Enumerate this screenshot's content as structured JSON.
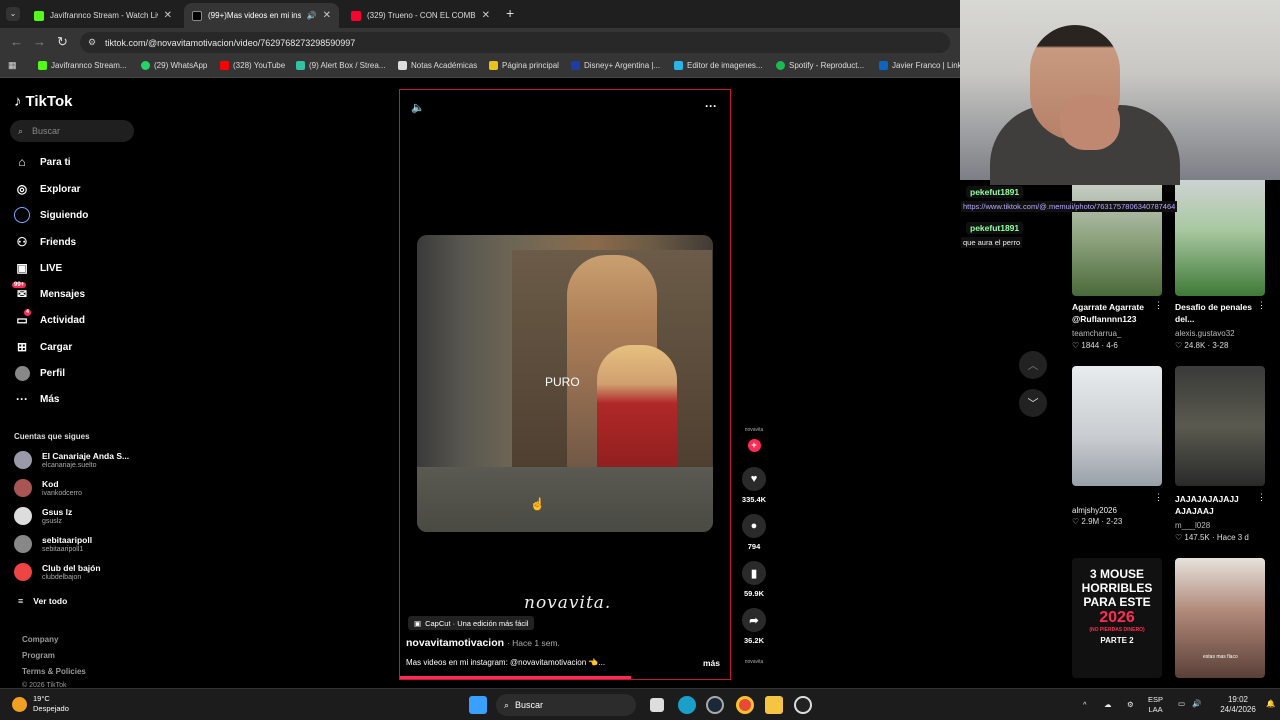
{
  "browser": {
    "tabs": [
      {
        "title": "Javifrannco Stream - Watch Live",
        "color": "#53fc18"
      },
      {
        "title": "(99+)Mas videos en mi insta...",
        "color": "#ffffff"
      },
      {
        "title": "(329) Trueno - CON EL COMBO",
        "color": "#ff0033"
      }
    ],
    "url": "tiktok.com/@novavitamotivacion/video/7629768273298590997",
    "bookmarks": [
      {
        "label": "Javifrannco Stream...",
        "color": "#53fc18"
      },
      {
        "label": "(29) WhatsApp",
        "color": "#25d366"
      },
      {
        "label": "(328) YouTube",
        "color": "#ff0000"
      },
      {
        "label": "(9) Alert Box / Strea...",
        "color": "#31c3a2"
      },
      {
        "label": "Notas Académicas",
        "color": "#dddddd"
      },
      {
        "label": "Página principal",
        "color": "#e8c21f"
      },
      {
        "label": "Disney+ Argentina |...",
        "color": "#1c3ca8"
      },
      {
        "label": "Editor de imagenes...",
        "color": "#2bb5e6"
      },
      {
        "label": "Spotify - Reproduct...",
        "color": "#1db954"
      },
      {
        "label": "Javier Franco | Link...",
        "color": "#0a66c2"
      }
    ]
  },
  "tiktok": {
    "logo": "TikTok",
    "search_placeholder": "Buscar",
    "nav": [
      {
        "label": "Para ti",
        "icon": "home-icon"
      },
      {
        "label": "Explorar",
        "icon": "compass-icon"
      },
      {
        "label": "Siguiendo",
        "icon": "following-icon"
      },
      {
        "label": "Friends",
        "icon": "friends-icon"
      },
      {
        "label": "LIVE",
        "icon": "live-icon"
      },
      {
        "label": "Mensajes",
        "icon": "messages-icon",
        "badge": "99+"
      },
      {
        "label": "Actividad",
        "icon": "activity-icon",
        "badge": "4"
      },
      {
        "label": "Cargar",
        "icon": "upload-icon"
      },
      {
        "label": "Perfil",
        "icon": "profile-icon"
      },
      {
        "label": "Más",
        "icon": "more-icon"
      }
    ],
    "following_title": "Cuentas que sigues",
    "following": [
      {
        "name": "El Canariaje Anda S...",
        "handle": "elcanariaje.suelto"
      },
      {
        "name": "Kod",
        "handle": "ivankodcerro"
      },
      {
        "name": "Gsus lz",
        "handle": "gsuslz"
      },
      {
        "name": "sebitaaripoll",
        "handle": "sebitaaripoll1"
      },
      {
        "name": "Club del bajón",
        "handle": "clubdelbajon"
      }
    ],
    "see_all": "Ver todo",
    "footer": [
      "Company",
      "Program",
      "Terms & Policies",
      "© 2026 TikTok"
    ],
    "video": {
      "overlay_text": "PURO",
      "brand": "novavita.",
      "capcut": "CapCut · Una edición más fácil",
      "username": "novavitamotivacion",
      "time": "· Hace 1 sem.",
      "description": "Mas videos en mi instagram: @novavitamotivacion 👈...",
      "more": "más",
      "progress": 0.7,
      "avatar_label": "novavita",
      "likes": "335.4K",
      "comments": "794",
      "saves": "59.9K",
      "shares": "36.2K",
      "end_label": "novavita"
    },
    "related": [
      {
        "caption": "Agarrate Agarrate @Ruflannnn123",
        "user": "teamcharrua_",
        "stats": "♡ 1844 · 4-6"
      },
      {
        "caption": "Desafio de penales del...",
        "user": "alexis.gustavo32",
        "stats": "♡ 24.8K · 3-28"
      },
      {
        "caption": "",
        "user": "almjshy2026",
        "stats": "♡ 2.9M · 2-23"
      },
      {
        "caption": "JAJAJAJAJAJJ AJAJAAJ",
        "user": "m___l028",
        "stats": "♡ 147.5K · Hace 3 d"
      }
    ],
    "thumb_texts": [
      "3 MOUSE",
      "HORRIBLES",
      "PARA ESTE",
      "2026",
      "(NO PIERDAS DINERO)",
      "PARTE 2",
      "estas mas flaco"
    ]
  },
  "stream_chat": [
    {
      "user": "pekefut1891",
      "message": "https://www.tiktok.com/@.memuii/photo/7631757806340787464"
    },
    {
      "user": "pekefut1891",
      "message": "que aura el perro"
    }
  ],
  "taskbar": {
    "weather_temp": "19°C",
    "weather_desc": "Despejado",
    "search": "Buscar",
    "lang_top": "ESP",
    "lang_bottom": "LAA",
    "time": "19:02",
    "date": "24/4/2026"
  }
}
